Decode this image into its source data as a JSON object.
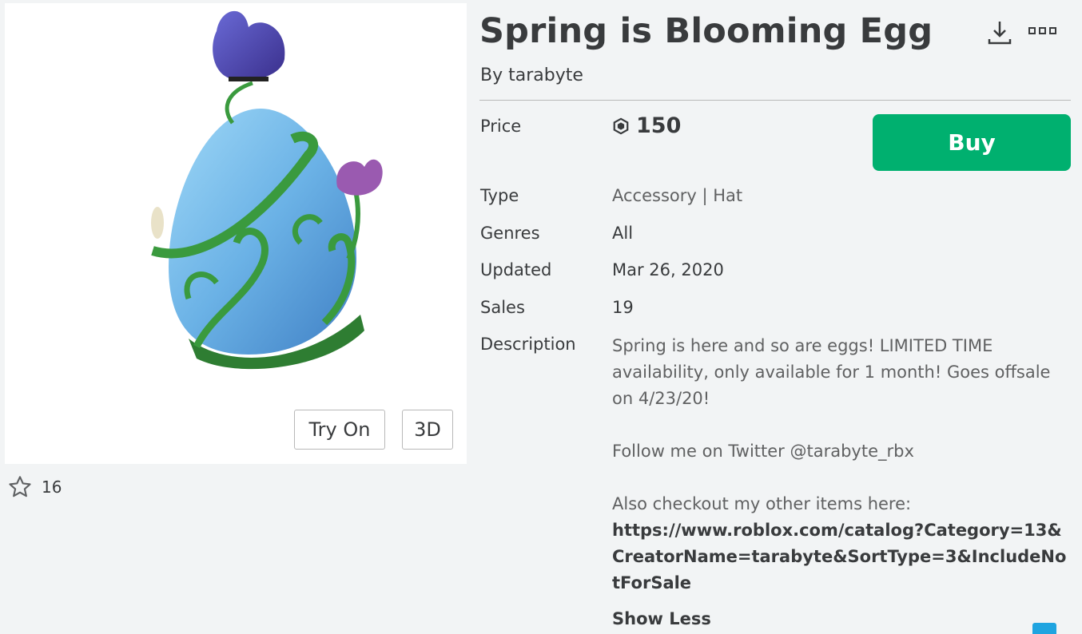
{
  "item": {
    "title": "Spring is Blooming Egg",
    "by_prefix": "By",
    "creator": "tarabyte"
  },
  "thumbnail": {
    "try_on_label": "Try On",
    "three_d_label": "3D"
  },
  "favorites": {
    "count": "16"
  },
  "details": {
    "price_label": "Price",
    "price_value": "150",
    "buy_label": "Buy",
    "type_label": "Type",
    "type_value": "Accessory | Hat",
    "genres_label": "Genres",
    "genres_value": "All",
    "updated_label": "Updated",
    "updated_value": "Mar 26, 2020",
    "sales_label": "Sales",
    "sales_value": "19",
    "description_label": "Description"
  },
  "description": {
    "line1": "Spring is here and so are eggs! LIMITED TIME availability, only available for 1 month! Goes offsale on 4/23/20!",
    "line2": "Follow me on Twitter @tarabyte_rbx",
    "line3": "Also checkout my other items here:",
    "link": "https://www.roblox.com/catalog?Category=13&CreatorName=tarabyte&SortType=3&IncludeNotForSale",
    "show_less": "Show Less"
  },
  "colors": {
    "buy_green": "#00b06f",
    "text_dark": "#393b3d",
    "text_muted": "#606162",
    "page_bg": "#f2f4f5"
  },
  "icons": [
    "download-icon",
    "more-options-icon",
    "star-icon",
    "robux-icon"
  ]
}
